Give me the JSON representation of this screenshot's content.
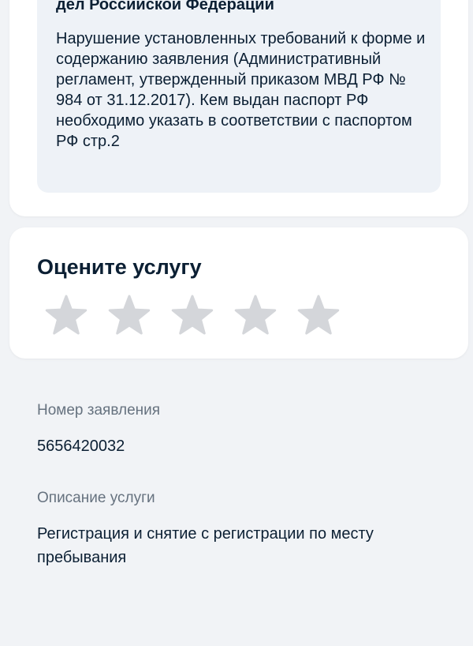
{
  "notice": {
    "heading_line": "дел Российской Федерации",
    "text": "Нарушение установленных требований к форме и содержанию заявления (Административный регламент, утвержденный приказом МВД РФ № 984 от 31.12.2017). Кем выдан паспорт РФ необходимо указать в соответствии с паспортом РФ стр.2"
  },
  "rating": {
    "title": "Оцените услугу",
    "stars_total": 5,
    "stars_selected": 0,
    "star_color": "#d4d6da"
  },
  "application": {
    "number_label": "Номер заявления",
    "number_value": "5656420032",
    "description_label": "Описание услуги",
    "description_value": "Регистрация и снятие с регистрации по месту пребывания"
  }
}
